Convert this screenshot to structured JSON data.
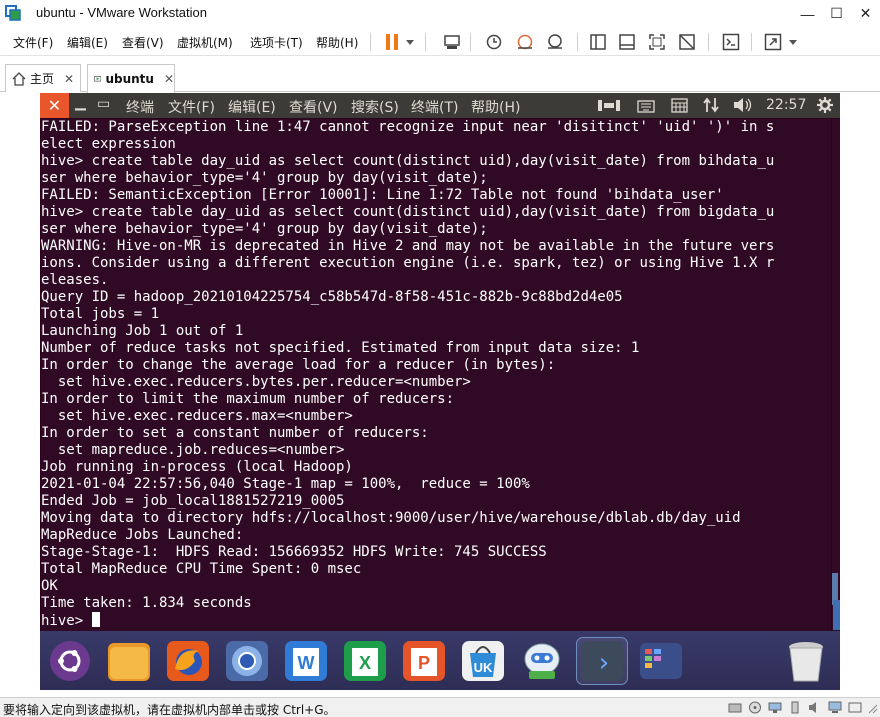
{
  "window": {
    "title": "ubuntu - VMware Workstation",
    "minimize": "—",
    "maximize": "☐",
    "close": "✕"
  },
  "menu": {
    "file": "文件(F)",
    "edit": "编辑(E)",
    "view": "查看(V)",
    "vm": "虚拟机(M)",
    "tabs": "选项卡(T)",
    "help": "帮助(H)"
  },
  "tabs": [
    {
      "label": "主页"
    },
    {
      "label": "ubuntu"
    }
  ],
  "ubuntu": {
    "close_glyph": "✕",
    "app_name": "终端",
    "menus": [
      "文件(F)",
      "编辑(E)",
      "查看(V)",
      "搜索(S)",
      "终端(T)",
      "帮助(H)"
    ],
    "time": "22:57"
  },
  "terminal": {
    "lines": [
      "FAILED: ParseException line 1:47 cannot recognize input near 'disitinct' 'uid' ')' in s",
      "elect expression",
      "hive> create table day_uid as select count(distinct uid),day(visit_date) from bihdata_u",
      "ser where behavior_type='4' group by day(visit_date);",
      "FAILED: SemanticException [Error 10001]: Line 1:72 Table not found 'bihdata_user'",
      "hive> create table day_uid as select count(distinct uid),day(visit_date) from bigdata_u",
      "ser where behavior_type='4' group by day(visit_date);",
      "WARNING: Hive-on-MR is deprecated in Hive 2 and may not be available in the future vers",
      "ions. Consider using a different execution engine (i.e. spark, tez) or using Hive 1.X r",
      "eleases.",
      "Query ID = hadoop_20210104225754_c58b547d-8f58-451c-882b-9c88bd2d4e05",
      "Total jobs = 1",
      "Launching Job 1 out of 1",
      "Number of reduce tasks not specified. Estimated from input data size: 1",
      "In order to change the average load for a reducer (in bytes):",
      "  set hive.exec.reducers.bytes.per.reducer=<number>",
      "In order to limit the maximum number of reducers:",
      "  set hive.exec.reducers.max=<number>",
      "In order to set a constant number of reducers:",
      "  set mapreduce.job.reduces=<number>",
      "Job running in-process (local Hadoop)",
      "2021-01-04 22:57:56,040 Stage-1 map = 100%,  reduce = 100%",
      "Ended Job = job_local1881527219_0005",
      "Moving data to directory hdfs://localhost:9000/user/hive/warehouse/dblab.db/day_uid",
      "MapReduce Jobs Launched:",
      "Stage-Stage-1:  HDFS Read: 156669352 HDFS Write: 745 SUCCESS",
      "Total MapReduce CPU Time Spent: 0 msec",
      "OK",
      "Time taken: 1.834 seconds"
    ],
    "prompt": "hive> "
  },
  "dock": {
    "items": [
      "ubuntu-logo",
      "files",
      "firefox",
      "chromium",
      "wps-writer",
      "wps-spreadsheets",
      "wps-presentation",
      "ubuntu-kylin-software",
      "update-manager",
      "terminal",
      "workspace-switcher",
      "trash"
    ],
    "ms_word_letter": "W",
    "spreadsheet_letter": "X",
    "presentation_letter": "P",
    "software_center_text": "UK",
    "terminal_glyph": "›"
  },
  "status": {
    "message": "要将输入定向到该虚拟机，请在虚拟机内部单击或按 Ctrl+G。"
  }
}
